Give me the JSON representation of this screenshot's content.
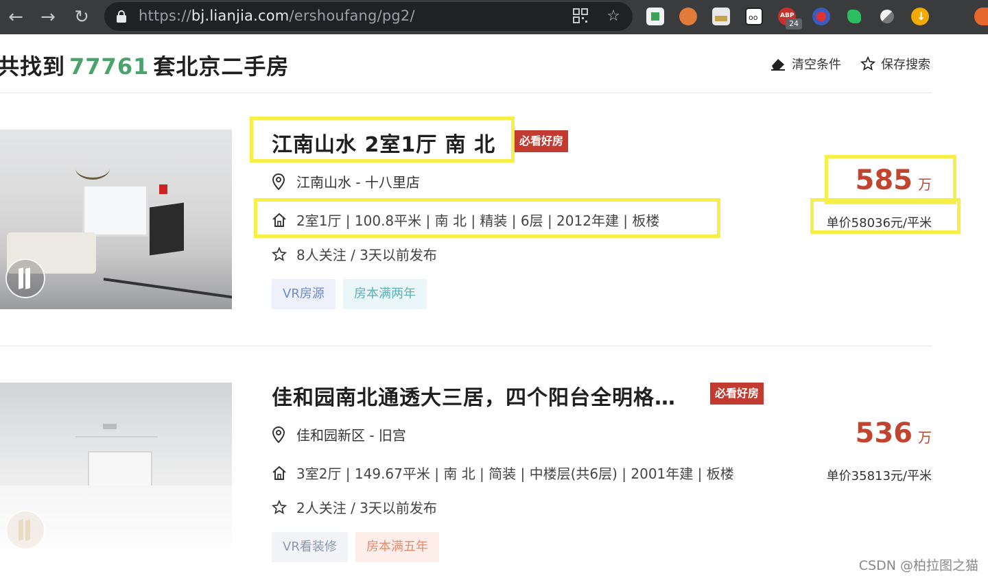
{
  "browser": {
    "url_scheme": "https://",
    "url_host": "bj.lianjia.com",
    "url_path": "/ershoufang/pg2/",
    "ext_badge": "24",
    "ext_abp_label": "ABP"
  },
  "header": {
    "prefix": "共找到",
    "count": "77761",
    "suffix": "套北京二手房",
    "clear_label": "清空条件",
    "save_label": "保存搜索"
  },
  "listings": [
    {
      "title": "江南山水 2室1厅 南 北",
      "badge": "必看好房",
      "location": "江南山水 - 十八里店",
      "info": "2室1厅 | 100.8平米 | 南 北 | 精装 | 6层 | 2012年建 | 板楼",
      "follow": "8人关注 / 3天以前发布",
      "tags": [
        "VR房源",
        "房本满两年"
      ],
      "price": "585",
      "price_unit": "万",
      "unit_price": "单价58036元/平米"
    },
    {
      "title": "佳和园南北通透大三居，四个阳台全明格…",
      "badge": "必看好房",
      "location": "佳和园新区 - 旧宫",
      "info": "3室2厅 | 149.67平米 | 南 北 | 简装 | 中楼层(共6层) | 2001年建 | 板楼",
      "follow": "2人关注 / 3天以前发布",
      "tags": [
        "VR看装修",
        "房本满五年"
      ],
      "price": "536",
      "price_unit": "万",
      "unit_price": "单价35813元/平米"
    }
  ],
  "watermark": "CSDN @柏拉图之猫",
  "colors": {
    "count_green": "#4aa36b",
    "price_red": "#c0442e",
    "badge_red": "#c33b30",
    "highlight_yellow": "#f7ee47"
  }
}
